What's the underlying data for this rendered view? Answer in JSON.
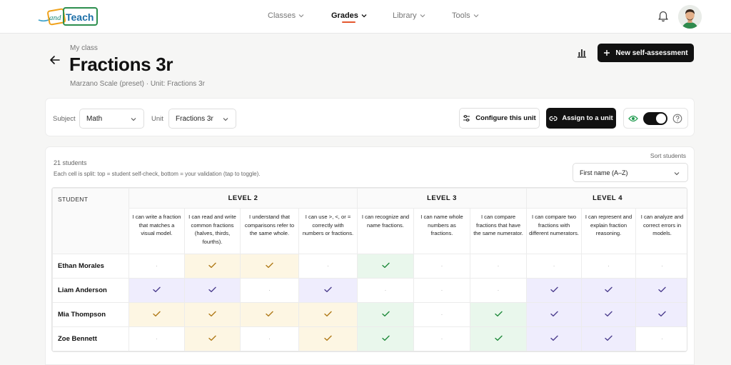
{
  "nav": {
    "logo_text_1": "and",
    "logo_text_2": "Teach",
    "items": [
      {
        "label": "Classes"
      },
      {
        "label": "Grades"
      },
      {
        "label": "Library"
      },
      {
        "label": "Tools"
      }
    ],
    "active": "Grades"
  },
  "header": {
    "kicker": "My class",
    "title": "Fractions 3r",
    "subtitle": "Marzano Scale (preset) · Unit: Fractions 3r",
    "new_button": "New self-assessment"
  },
  "filters": {
    "subject_label": "Subject",
    "subject_value": "Math",
    "unit_label": "Unit",
    "unit_value": "Fractions 3r",
    "configure_button": "Configure this unit",
    "assign_button": "Assign to a unit",
    "toggle_on": true
  },
  "roster": {
    "count": "21 students",
    "hint": "Each cell is split: top = student self-check, bottom = your validation (tap to toggle).",
    "sort_label": "Sort students",
    "sort_value": "First name (A–Z)"
  },
  "grid": {
    "student_header": "STUDENT",
    "levels": [
      {
        "label": "LEVEL 2",
        "span": 4
      },
      {
        "label": "LEVEL 3",
        "span": 3
      },
      {
        "label": "LEVEL 4",
        "span": 3
      }
    ],
    "criteria": [
      "I can write a fraction that matches a visual model.",
      "I can read and write common fractions (halves, thirds, fourths).",
      "I understand that comparisons refer to the same whole.",
      "I can use >, <, or = correctly with numbers or fractions.",
      "I can recognize and name fractions.",
      "I can name whole numbers as fractions.",
      "I can compare fractions that have the same numerator.",
      "I can compare two fractions with different numerators.",
      "I can represent and explain fraction reasoning.",
      "I can analyze and correct errors in models."
    ],
    "rows": [
      {
        "name": "Ethan Morales",
        "cells": [
          "dot",
          "y-check",
          "y-check",
          "dot",
          "g-check",
          "dot",
          "dot",
          "dot",
          "dot",
          "dot"
        ]
      },
      {
        "name": "Liam Anderson",
        "cells": [
          "p-check",
          "p-check",
          "dot",
          "p-check",
          "dot",
          "dot",
          "dot",
          "p-check",
          "p-check",
          "p-check"
        ]
      },
      {
        "name": "Mia Thompson",
        "cells": [
          "y-check",
          "y-check",
          "y-check",
          "y-check",
          "g-check",
          "dot",
          "g-check",
          "p-check",
          "p-check",
          "p-check"
        ]
      },
      {
        "name": "Zoe Bennett",
        "cells": [
          "dot",
          "y-check",
          "dot",
          "y-check",
          "g-check",
          "dot",
          "g-check",
          "p-check",
          "p-check",
          "dot"
        ]
      }
    ]
  },
  "colors": {
    "accent": "#e4572e",
    "level2_bg": "#fdf6e3",
    "level3_bg": "#e9f7ec",
    "level4_bg": "#efedfd",
    "primary_button": "#111111"
  }
}
